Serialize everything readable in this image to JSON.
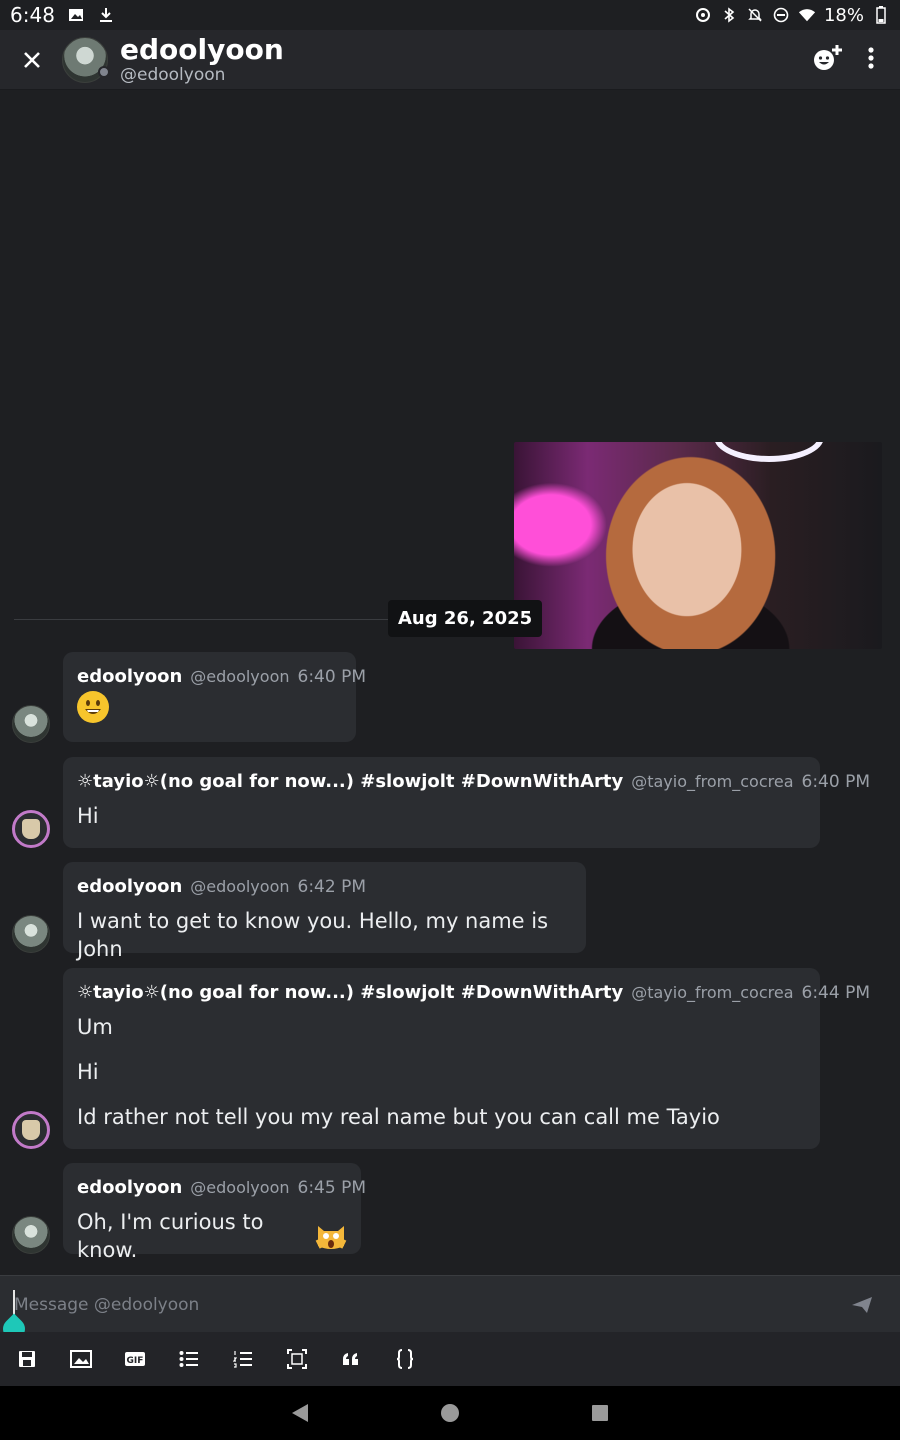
{
  "status_bar": {
    "time": "6:48",
    "battery": "18%"
  },
  "header": {
    "title": "edoolyoon",
    "subtitle": "@edoolyoon"
  },
  "date_divider": "Aug 26, 2025",
  "messages": [
    {
      "name": "edoolyoon",
      "handle": "@edoolyoon",
      "time": "6:40 PM",
      "lines": []
    },
    {
      "name": "☼tayio☼(no goal for now...) #slowjolt #DownWithArty",
      "handle": "@tayio_from_cocrea",
      "time": "6:40 PM",
      "lines": [
        "Hi"
      ]
    },
    {
      "name": "edoolyoon",
      "handle": "@edoolyoon",
      "time": "6:42 PM",
      "lines": [
        "I want to get to know you. Hello, my name is John"
      ]
    },
    {
      "name": "☼tayio☼(no goal for now...) #slowjolt #DownWithArty",
      "handle": "@tayio_from_cocrea",
      "time": "6:44 PM",
      "lines": [
        "Um",
        "Hi",
        "Id rather not tell you my real name but you can call me Tayio"
      ]
    },
    {
      "name": "edoolyoon",
      "handle": "@edoolyoon",
      "time": "6:45 PM",
      "lines": [
        "Oh, I'm curious to know."
      ]
    }
  ],
  "composer": {
    "placeholder": "Message @edoolyoon"
  },
  "colors": {
    "background": "#1e1f22",
    "bubble": "#2b2d31",
    "accent_handle": "#1ec8b8"
  }
}
